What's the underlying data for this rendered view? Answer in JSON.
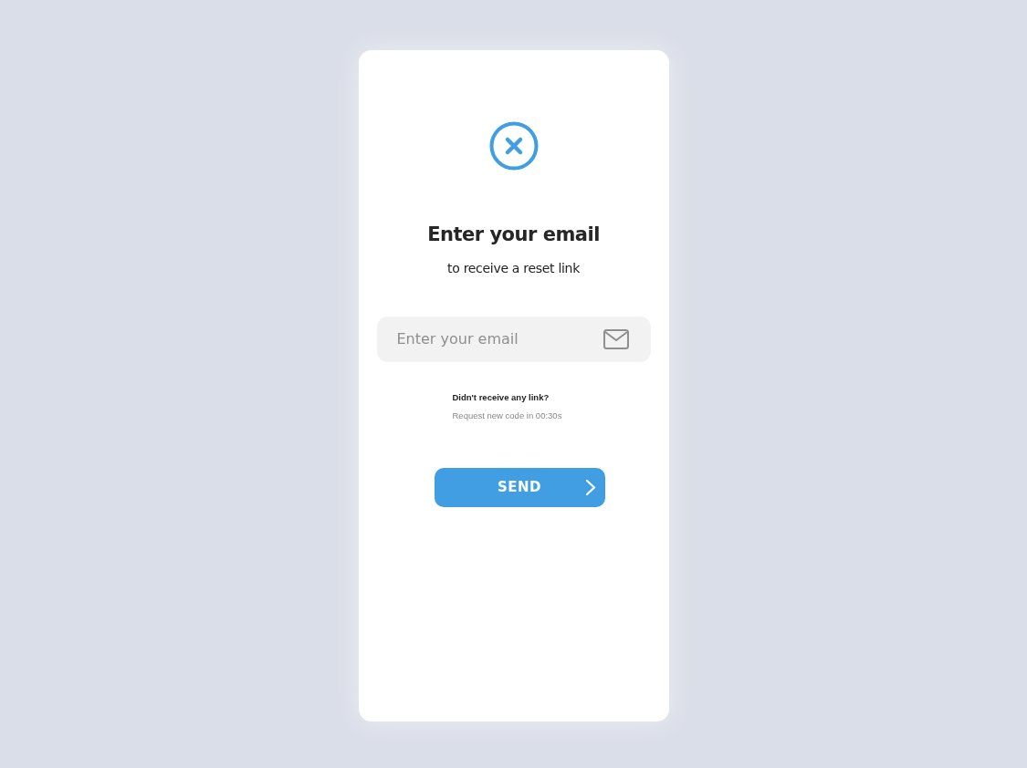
{
  "title": "Enter your email",
  "subtitle": "to receive a reset link",
  "email_field": {
    "placeholder": "Enter your email"
  },
  "resend": {
    "question": "Didn't receive any link?",
    "timer": "Request new code in 00:30s"
  },
  "send_button": {
    "label": "SEND"
  }
}
